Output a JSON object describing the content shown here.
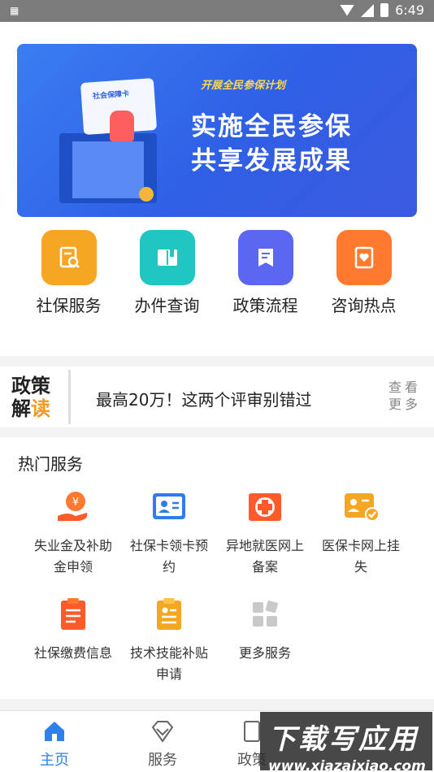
{
  "status_bar": {
    "time": "6:49",
    "left_icon": "qr-icon"
  },
  "banner": {
    "tag": "开展全民参保计划",
    "line1": "实施全民参保",
    "line2": "共享发展成果",
    "card_text": "社会保障卡"
  },
  "quick_menu": [
    {
      "label": "社保服务",
      "icon": "doc-search-icon",
      "color": "#f5a623"
    },
    {
      "label": "办件查询",
      "icon": "book-icon",
      "color": "#20c7c2"
    },
    {
      "label": "政策流程",
      "icon": "policy-doc-icon",
      "color": "#5b67f0"
    },
    {
      "label": "咨询热点",
      "icon": "heart-note-icon",
      "color": "#ff7a2f"
    }
  ],
  "policy": {
    "logo_top": "政策",
    "logo_bottom_a": "解",
    "logo_bottom_b": "读",
    "headline": "最高20万！这两个评审别错过",
    "more_line1": "查看",
    "more_line2": "更多"
  },
  "hot_services": {
    "title": "热门服务",
    "items": [
      {
        "label_line1": "失业金及补助",
        "label_line2": "金申领",
        "icon": "money-hand-icon"
      },
      {
        "label_line1": "社保卡领卡预",
        "label_line2": "约",
        "icon": "id-card-icon"
      },
      {
        "label_line1": "异地就医网上",
        "label_line2": "备案",
        "icon": "medical-cross-icon"
      },
      {
        "label_line1": "医保卡网上挂",
        "label_line2": "失",
        "icon": "card-check-icon"
      },
      {
        "label_line1": "社保缴费信息",
        "label_line2": "",
        "icon": "clipboard-icon"
      },
      {
        "label_line1": "技术技能补贴",
        "label_line2": "申请",
        "icon": "clipboard-yellow-icon"
      },
      {
        "label_line1": "更多服务",
        "label_line2": "",
        "icon": "grid-more-icon"
      }
    ]
  },
  "bottom_nav": [
    {
      "label": "主页",
      "icon": "home-icon",
      "active": true
    },
    {
      "label": "服务",
      "icon": "diamond-icon",
      "active": false
    },
    {
      "label": "政策",
      "icon": "policy-icon",
      "active": false
    }
  ],
  "watermark": {
    "line1": "下载写应用",
    "line2": "www.xiazaixiao.com"
  },
  "colors": {
    "accent": "#2f80ed",
    "banner": "#3a6ff0"
  }
}
